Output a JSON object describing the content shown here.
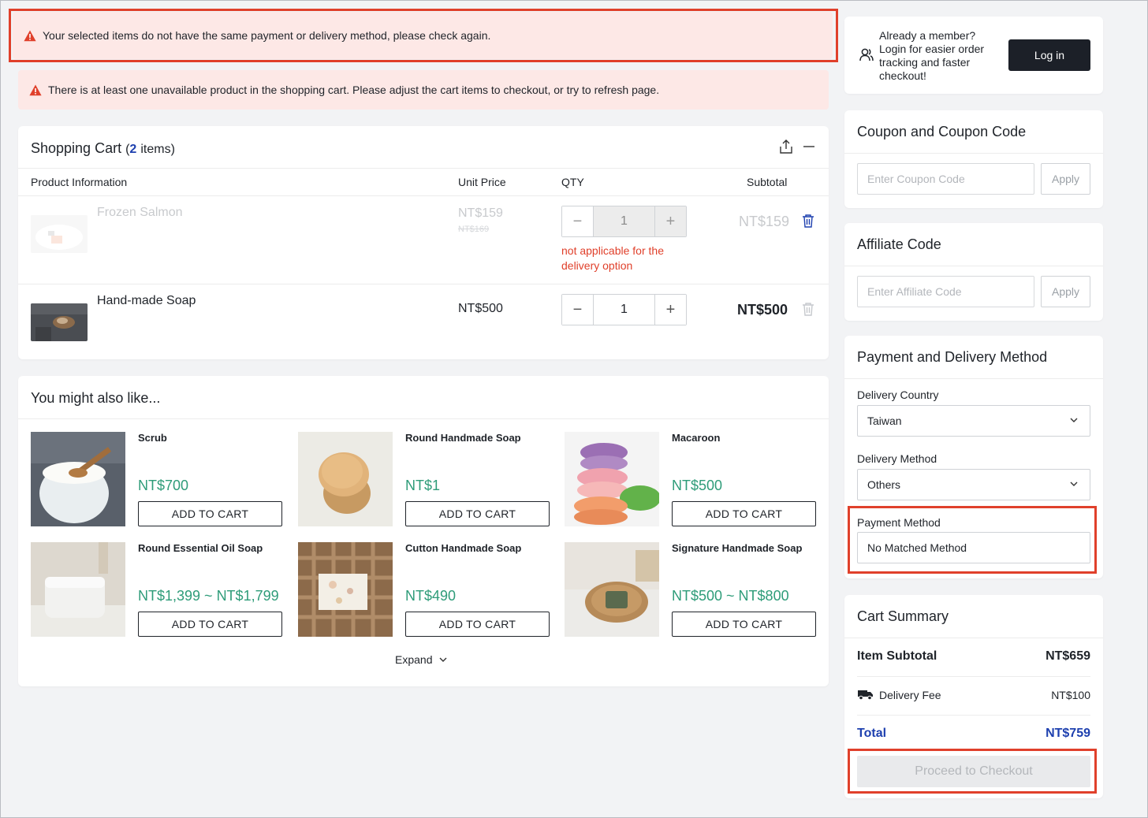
{
  "alerts": {
    "method_mismatch": "Your selected items do not have the same payment or delivery method, please check again.",
    "unavailable": "There is at least one unavailable product in the shopping cart. Please adjust the cart items to checkout, or try to refresh page."
  },
  "cart": {
    "title_prefix": "Shopping Cart",
    "title_paren_open": "(",
    "count": "2",
    "title_suffix": "items)",
    "headers": {
      "product": "Product Information",
      "unit_price": "Unit Price",
      "qty": "QTY",
      "subtotal": "Subtotal"
    },
    "items": [
      {
        "name": "Frozen Salmon",
        "price": "NT$159",
        "original_price": "NT$169",
        "qty": "1",
        "subtotal": "NT$159",
        "warning": "not applicable for the delivery option",
        "unavailable": true
      },
      {
        "name": "Hand-made Soap",
        "price": "NT$500",
        "qty": "1",
        "subtotal": "NT$500",
        "unavailable": false
      }
    ]
  },
  "recommend": {
    "title": "You might also like...",
    "add_label": "ADD TO CART",
    "expand_label": "Expand",
    "items": [
      {
        "name": "Scrub",
        "price": "NT$700"
      },
      {
        "name": "Round Handmade Soap",
        "price": "NT$1"
      },
      {
        "name": "Macaroon",
        "price": "NT$500"
      },
      {
        "name": "Round Essential Oil Soap",
        "price": "NT$1,399 ~ NT$1,799"
      },
      {
        "name": "Cutton Handmade Soap",
        "price": "NT$490"
      },
      {
        "name": "Signature Handmade Soap",
        "price": "NT$500 ~ NT$800"
      }
    ]
  },
  "login": {
    "message": "Already a member? Login for easier order tracking and faster checkout!",
    "button": "Log in"
  },
  "coupon": {
    "title": "Coupon and Coupon Code",
    "placeholder": "Enter Coupon Code",
    "apply": "Apply"
  },
  "affiliate": {
    "title": "Affiliate Code",
    "placeholder": "Enter Affiliate Code",
    "apply": "Apply"
  },
  "payment_delivery": {
    "title": "Payment and Delivery Method",
    "country_label": "Delivery Country",
    "country_value": "Taiwan",
    "method_label": "Delivery Method",
    "method_value": "Others",
    "payment_label": "Payment Method",
    "payment_value": "No Matched Method"
  },
  "summary": {
    "title": "Cart Summary",
    "item_subtotal_label": "Item Subtotal",
    "item_subtotal": "NT$659",
    "delivery_fee_label": "Delivery Fee",
    "delivery_fee": "NT$100",
    "total_label": "Total",
    "total": "NT$759",
    "checkout": "Proceed to Checkout"
  },
  "colors": {
    "accent_blue": "#1e40af",
    "price_green": "#2e9c79",
    "error_red": "#e0402b",
    "alert_bg": "#fde8e6"
  }
}
